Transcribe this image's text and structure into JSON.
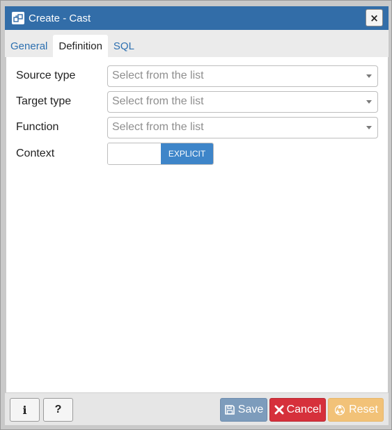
{
  "dialog": {
    "title": "Create - Cast",
    "close_label": "×"
  },
  "tabs": [
    {
      "label": "General",
      "active": false
    },
    {
      "label": "Definition",
      "active": true
    },
    {
      "label": "SQL",
      "active": false
    }
  ],
  "form": {
    "source_type": {
      "label": "Source type",
      "placeholder": "Select from the list"
    },
    "target_type": {
      "label": "Target type",
      "placeholder": "Select from the list"
    },
    "function": {
      "label": "Function",
      "placeholder": "Select from the list"
    },
    "context": {
      "label": "Context",
      "toggle_label": "EXPLICIT"
    }
  },
  "footer": {
    "info_label": "i",
    "help_label": "?",
    "save_label": "Save",
    "cancel_label": "Cancel",
    "reset_label": "Reset"
  },
  "icons": {
    "title": "cast-icon",
    "close": "close-icon",
    "save": "floppy-disk-icon",
    "cancel": "x-icon",
    "reset": "recycle-icon"
  },
  "colors": {
    "titlebar": "#326da8",
    "accent": "#3e85c9",
    "save": "#7d9cbc",
    "cancel": "#d6303b",
    "reset": "#f2c278"
  }
}
